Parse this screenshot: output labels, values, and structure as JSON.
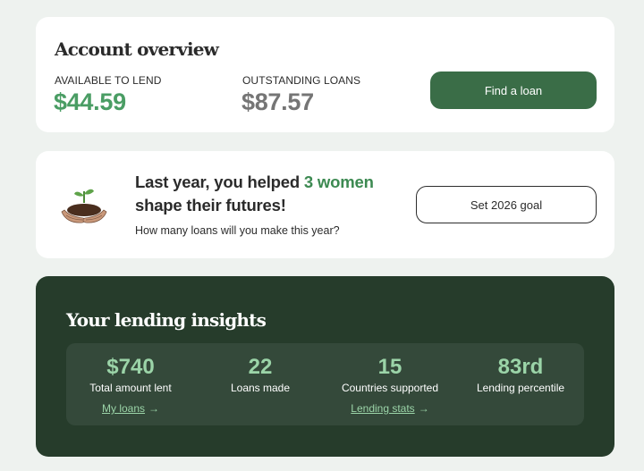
{
  "overview": {
    "title": "Account overview",
    "available_label": "AVAILABLE TO LEND",
    "available_value": "$44.59",
    "outstanding_label": "OUTSTANDING LOANS",
    "outstanding_value": "$87.57",
    "find_loan_label": "Find a loan"
  },
  "impact": {
    "headline_prefix": "Last year, you helped ",
    "headline_highlight": "3 women",
    "headline_suffix": "shape their futures!",
    "subtext": "How many loans will you make this year?",
    "goal_button_label": "Set 2026 goal",
    "icon": "plant-in-hands-icon"
  },
  "insights": {
    "title": "Your lending insights",
    "metrics": [
      {
        "value": "$740",
        "label": "Total amount lent",
        "link": "My loans"
      },
      {
        "value": "22",
        "label": "Loans made"
      },
      {
        "value": "15",
        "label": "Countries supported",
        "link": "Lending stats"
      },
      {
        "value": "83rd",
        "label": "Lending percentile"
      }
    ]
  },
  "colors": {
    "background": "#eef2ef",
    "accent_green": "#4a9d64",
    "primary_button": "#3a6d47",
    "insights_bg": "#263c2b",
    "insights_panel": "#34493a",
    "metric_green": "#9bd4a8"
  }
}
